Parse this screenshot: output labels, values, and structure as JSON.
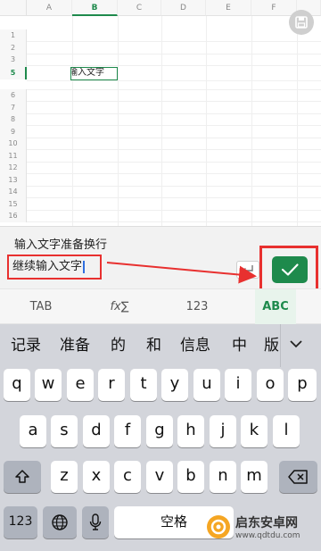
{
  "sheet": {
    "columns": [
      "A",
      "B",
      "C",
      "D",
      "E",
      "F"
    ],
    "active_column": "B",
    "rows": [
      "1",
      "2",
      "3",
      "4",
      "5",
      "6",
      "7",
      "8",
      "9",
      "10",
      "11",
      "12",
      "13",
      "14",
      "15",
      "16"
    ],
    "active_row": "5",
    "editing_cell_text": "输入文字"
  },
  "editor": {
    "line1": "输入文字准备换行",
    "line2": "继续输入文字"
  },
  "function_bar": {
    "tab": "TAB",
    "fx": "fx∑",
    "num": "123",
    "abc": "ABC",
    "selected": "ABC"
  },
  "keyboard": {
    "candidates": [
      "记录",
      "准备",
      "的",
      "和",
      "信息",
      "中",
      "版"
    ],
    "row1": [
      "q",
      "w",
      "e",
      "r",
      "t",
      "y",
      "u",
      "i",
      "o",
      "p"
    ],
    "row2": [
      "a",
      "s",
      "d",
      "f",
      "g",
      "h",
      "j",
      "k",
      "l"
    ],
    "row3": [
      "z",
      "x",
      "c",
      "v",
      "b",
      "n",
      "m"
    ],
    "num_key": "123",
    "space_label": "空格"
  },
  "watermark": {
    "name": "启东安卓网",
    "url": "www.qdtdu.com"
  },
  "colors": {
    "accent_green": "#1e8a4c",
    "highlight_red": "#e8302f"
  }
}
